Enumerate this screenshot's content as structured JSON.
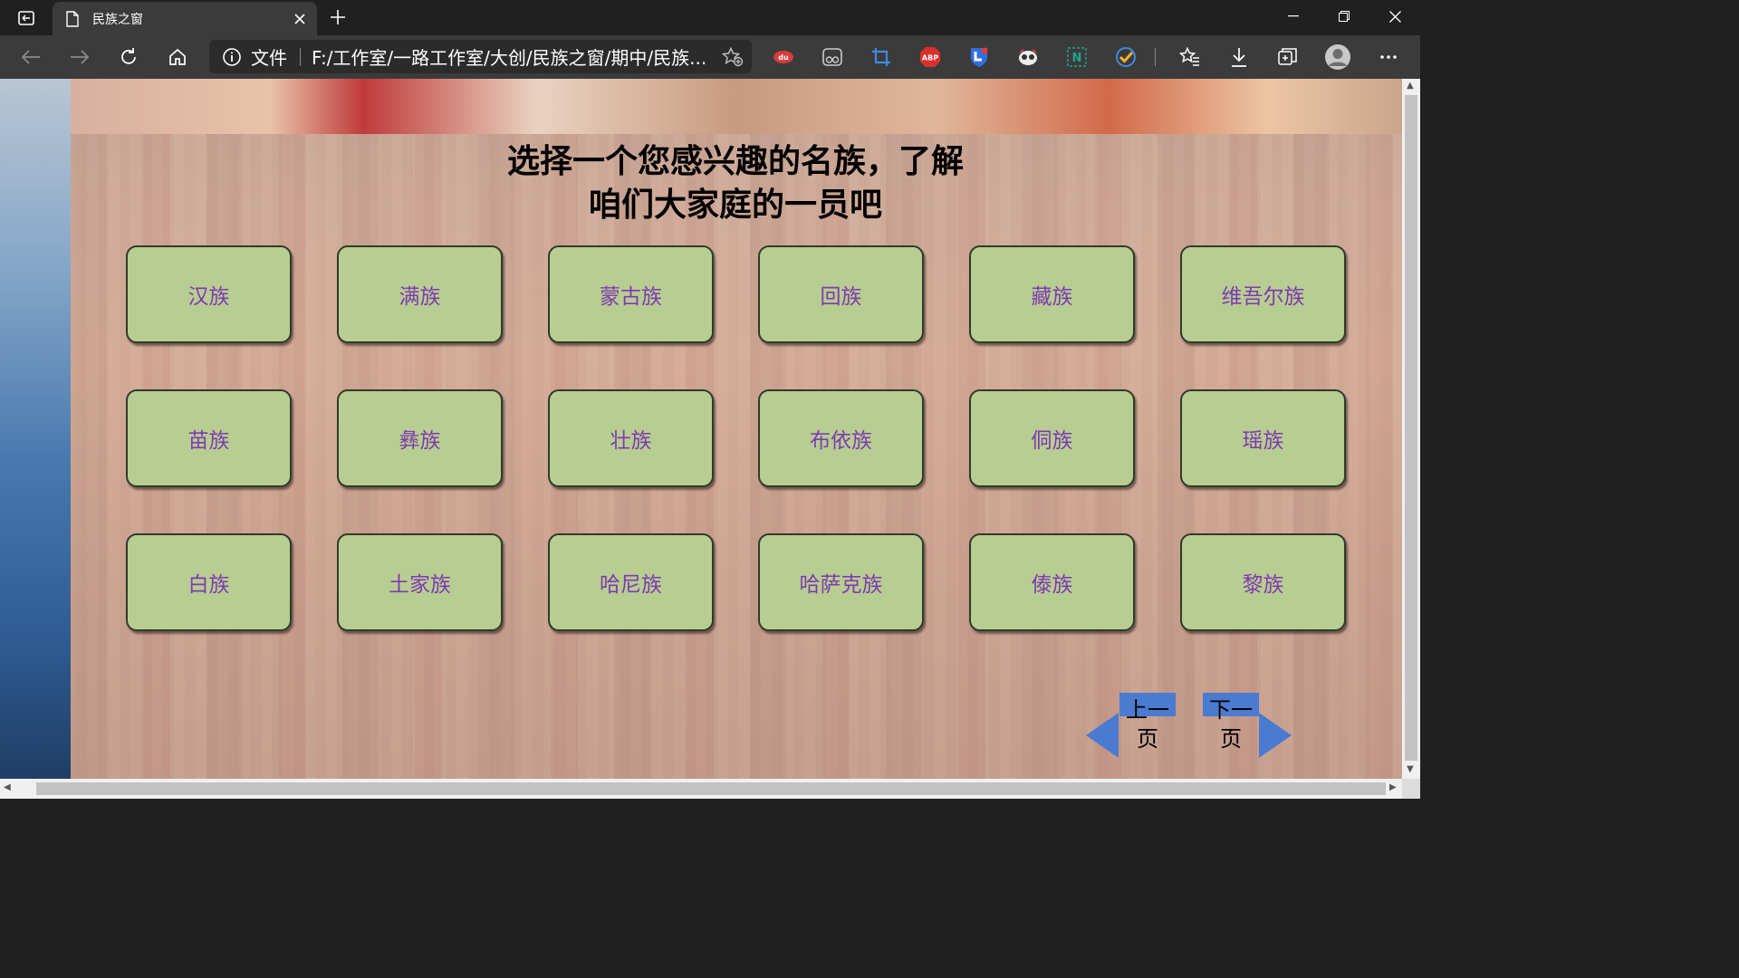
{
  "browser": {
    "tab": {
      "title": "民族之窗"
    },
    "address": {
      "scheme_label": "文件",
      "url": "F:/工作室/一路工作室/大创/民族之窗/期中/民族..."
    },
    "extensions": [
      {
        "name": "du",
        "label": "du",
        "color": "#d93b3b"
      },
      {
        "name": "reader",
        "label": "",
        "color": "#555555"
      },
      {
        "name": "crop",
        "label": "",
        "color": "#3f8ae0"
      },
      {
        "name": "abp",
        "label": "ABP",
        "color": "#d9302b"
      },
      {
        "name": "shield",
        "label": "",
        "color": "#2f6fe0"
      },
      {
        "name": "ghost",
        "label": "",
        "color": "#444444"
      },
      {
        "name": "notion",
        "label": "N",
        "color": "#1ba58a"
      },
      {
        "name": "check",
        "label": "",
        "color": "#f0b429"
      }
    ]
  },
  "page": {
    "heading_line1": "选择一个您感兴趣的名族，了解",
    "heading_line2": "咱们大家庭的一员吧",
    "ethnic_groups": [
      "汉族",
      "满族",
      "蒙古族",
      "回族",
      "藏族",
      "维吾尔族",
      "苗族",
      "彝族",
      "壮族",
      "布依族",
      "侗族",
      "瑶族",
      "白族",
      "土家族",
      "哈尼族",
      "哈萨克族",
      "傣族",
      "黎族"
    ],
    "nav": {
      "prev_line1": "上一",
      "prev_line2": "页",
      "next_line1": "下一",
      "next_line2": "页"
    }
  },
  "colors": {
    "button_fill": "#b8cd92",
    "button_text": "#7d3bb0",
    "nav_blue": "#4a7bd0"
  }
}
